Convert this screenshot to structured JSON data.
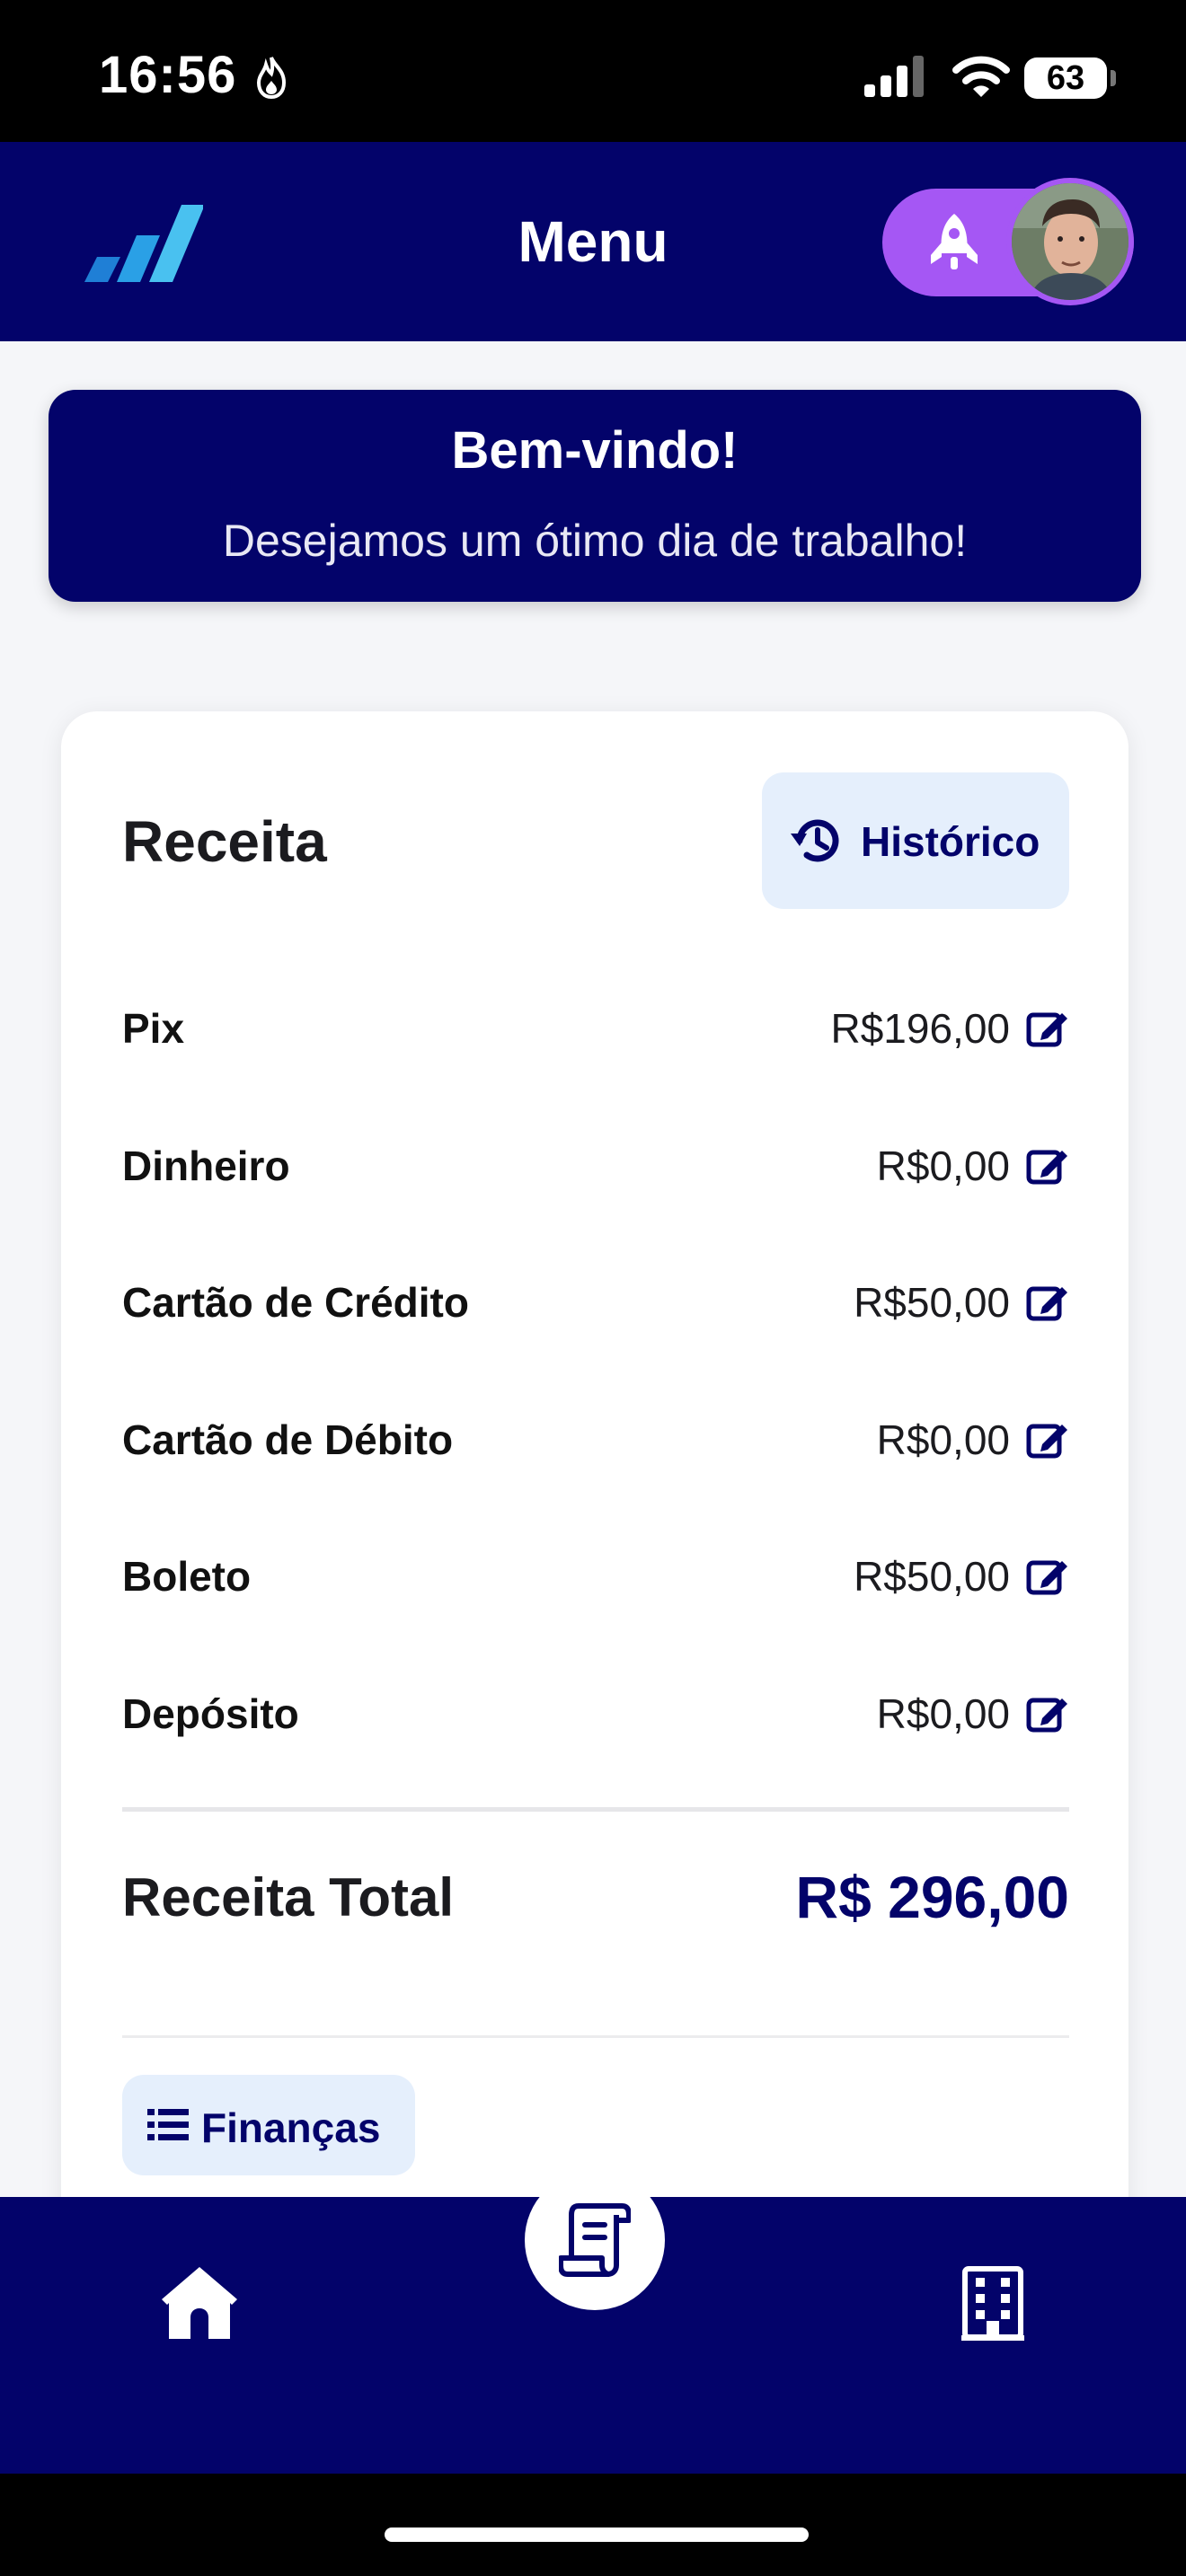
{
  "status_bar": {
    "time": "16:56",
    "battery": "63"
  },
  "header": {
    "title": "Menu",
    "accent_color": "#a557f4",
    "brand_color": "#03036a"
  },
  "welcome": {
    "title": "Bem-vindo!",
    "subtitle": "Desejamos um ótimo dia de trabalho!"
  },
  "revenue_card": {
    "title": "Receita",
    "history_label": "Histórico",
    "rows": [
      {
        "label": "Pix",
        "value": "R$196,00"
      },
      {
        "label": "Dinheiro",
        "value": "R$0,00"
      },
      {
        "label": "Cartão de Crédito",
        "value": "R$50,00"
      },
      {
        "label": "Cartão de Débito",
        "value": "R$0,00"
      },
      {
        "label": "Boleto",
        "value": "R$50,00"
      },
      {
        "label": "Depósito",
        "value": "R$0,00"
      }
    ],
    "total_label": "Receita Total",
    "total_value": "R$ 296,00",
    "finance_label": "Finanças"
  },
  "bottom_nav": {
    "items": [
      "home-icon",
      "receipt-icon",
      "building-icon"
    ]
  }
}
